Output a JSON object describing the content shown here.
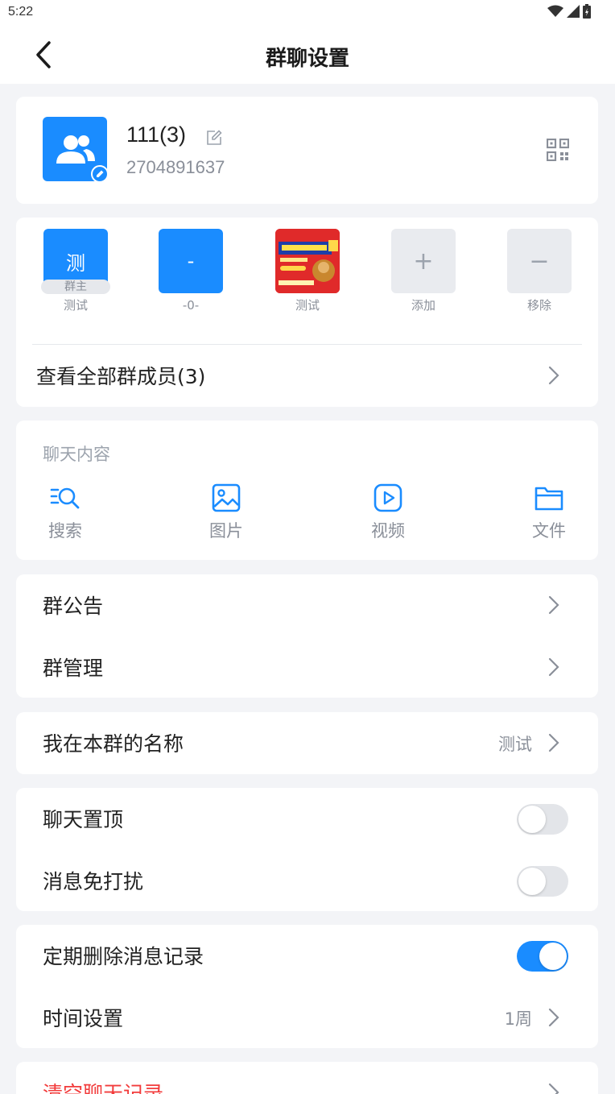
{
  "status_bar": {
    "time": "5:22"
  },
  "nav": {
    "title": "群聊设置"
  },
  "group": {
    "name": "111(3)",
    "id": "2704891637"
  },
  "members": [
    {
      "avatar_text": "测",
      "badge": "群主",
      "name": "测试"
    },
    {
      "avatar_text": "-",
      "name": "-0-"
    },
    {
      "avatar_image": "poster-image",
      "name": "测试"
    },
    {
      "avatar_text": "+",
      "name": "添加"
    },
    {
      "avatar_text": "−",
      "name": "移除"
    }
  ],
  "view_all_label": "查看全部群成员(3)",
  "chat_content": {
    "label": "聊天内容",
    "items": [
      {
        "icon": "search-icon",
        "label": "搜索"
      },
      {
        "icon": "image-icon",
        "label": "图片"
      },
      {
        "icon": "video-icon",
        "label": "视频"
      },
      {
        "icon": "folder-icon",
        "label": "文件"
      }
    ]
  },
  "rows": {
    "announcement": "群公告",
    "management": "群管理",
    "my_nickname": {
      "label": "我在本群的名称",
      "value": "测试"
    },
    "pin_chat": {
      "label": "聊天置顶",
      "on": false
    },
    "mute": {
      "label": "消息免打扰",
      "on": false
    },
    "auto_delete": {
      "label": "定期删除消息记录",
      "on": true
    },
    "time_setting": {
      "label": "时间设置",
      "value": "1周"
    },
    "clear_history": "清空聊天记录"
  },
  "colors": {
    "accent": "#1a8cff",
    "danger": "#f23c3c",
    "background": "#f3f4f7"
  }
}
